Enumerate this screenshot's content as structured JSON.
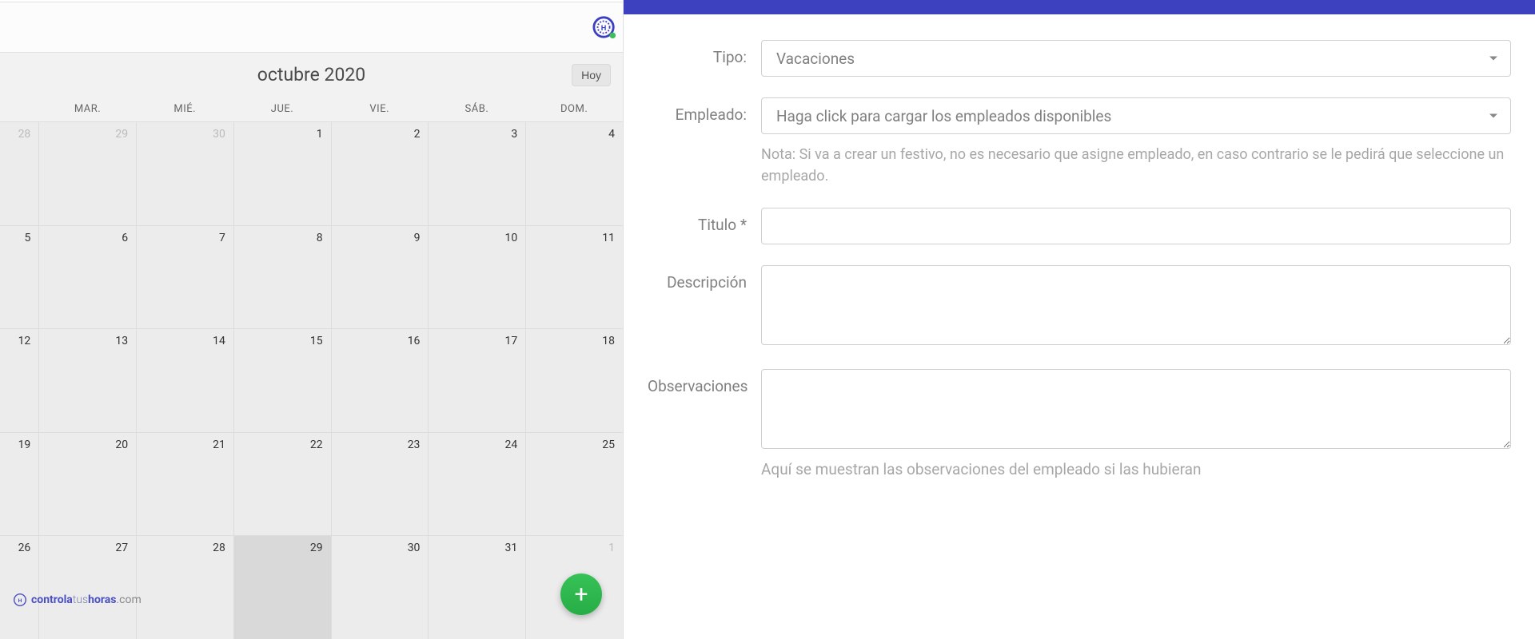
{
  "calendar": {
    "title": "octubre 2020",
    "today_button": "Hoy",
    "weekdays": [
      "",
      "MAR.",
      "MIÉ.",
      "JUE.",
      "VIE.",
      "SÁB.",
      "DOM."
    ],
    "weeks": [
      [
        {
          "n": "28",
          "other": true
        },
        {
          "n": "29",
          "other": true
        },
        {
          "n": "30",
          "other": true
        },
        {
          "n": "1"
        },
        {
          "n": "2"
        },
        {
          "n": "3"
        },
        {
          "n": "4"
        }
      ],
      [
        {
          "n": "5"
        },
        {
          "n": "6"
        },
        {
          "n": "7"
        },
        {
          "n": "8"
        },
        {
          "n": "9"
        },
        {
          "n": "10"
        },
        {
          "n": "11"
        }
      ],
      [
        {
          "n": "12"
        },
        {
          "n": "13"
        },
        {
          "n": "14"
        },
        {
          "n": "15"
        },
        {
          "n": "16"
        },
        {
          "n": "17"
        },
        {
          "n": "18"
        }
      ],
      [
        {
          "n": "19"
        },
        {
          "n": "20"
        },
        {
          "n": "21"
        },
        {
          "n": "22"
        },
        {
          "n": "23"
        },
        {
          "n": "24"
        },
        {
          "n": "25"
        }
      ],
      [
        {
          "n": "26"
        },
        {
          "n": "27"
        },
        {
          "n": "28"
        },
        {
          "n": "29",
          "highlight": true
        },
        {
          "n": "30"
        },
        {
          "n": "31"
        },
        {
          "n": "1",
          "other": true
        }
      ]
    ]
  },
  "footer": {
    "brand_prefix": "controla",
    "brand_mid": "tus",
    "brand_suffix": "horas",
    "brand_domain": ".com"
  },
  "form": {
    "tipo": {
      "label": "Tipo:",
      "value": "Vacaciones"
    },
    "empleado": {
      "label": "Empleado:",
      "placeholder": "Haga click para cargar los empleados disponibles",
      "note": "Nota: Si va a crear un festivo, no es necesario que asigne empleado, en caso contrario se le pedirá que seleccione un empleado."
    },
    "titulo": {
      "label": "Titulo *"
    },
    "descripcion": {
      "label": "Descripción"
    },
    "observaciones": {
      "label": "Observaciones",
      "help": "Aquí se muestran las observaciones del empleado si las hubieran"
    }
  }
}
